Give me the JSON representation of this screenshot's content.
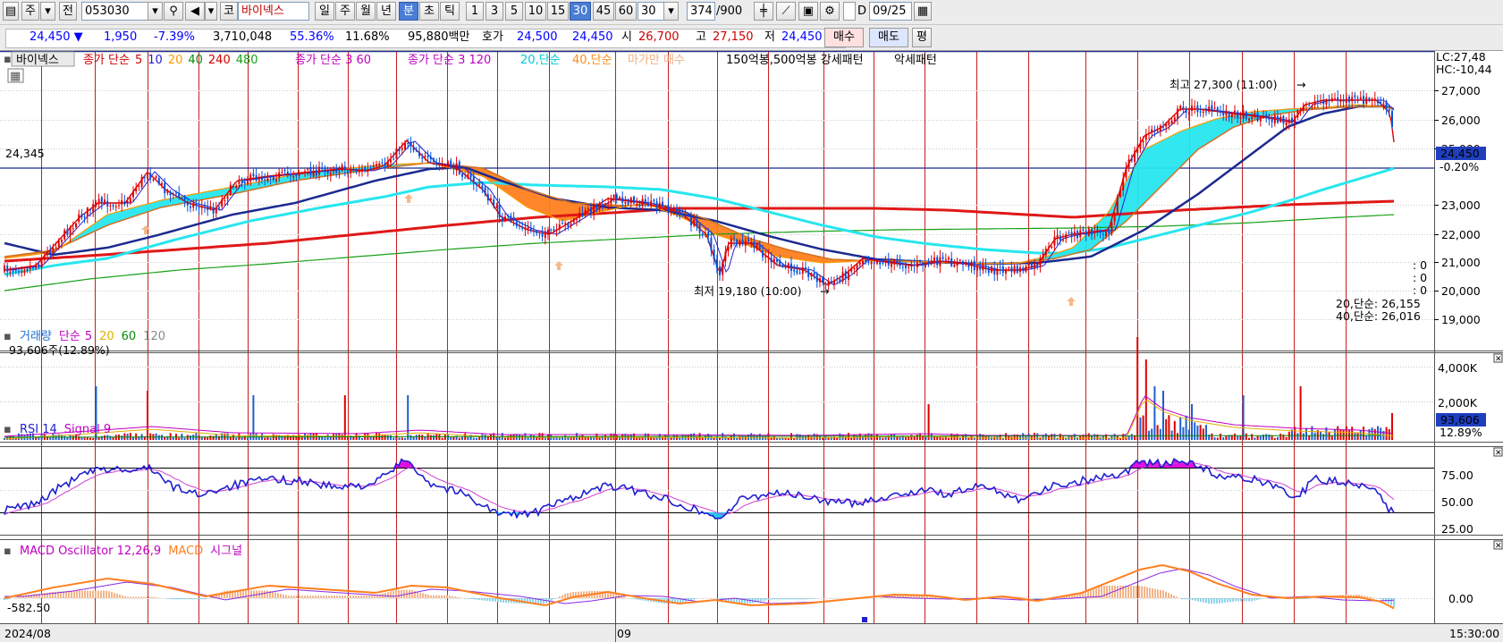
{
  "toolbar": {
    "main_label": "주",
    "prev_label": "전",
    "code_value": "053030",
    "market_label": "코",
    "stock_name": "바이넥스",
    "periods": [
      "일",
      "주",
      "월",
      "년",
      "분",
      "초",
      "틱"
    ],
    "intervals": [
      "1",
      "3",
      "5",
      "10",
      "15",
      "30",
      "45",
      "60"
    ],
    "interval_select": "30",
    "count": "374",
    "count_total": "/900",
    "d_label": "D",
    "date_value": "09/25"
  },
  "quote": {
    "price": "24,450",
    "change": "1,950",
    "change_pct": "-7.39%",
    "volume": "3,710,048",
    "vol_ratio": "55.36%",
    "turnover": "11.68%",
    "amount": "95,880백만",
    "hoga_label": "호가",
    "ask": "24,500",
    "bid": "24,450",
    "open_label": "시",
    "open": "26,700",
    "high_label": "고",
    "high": "27,150",
    "low_label": "저",
    "low": "24,450",
    "buy_label": "매수",
    "sell_label": "매도",
    "eval_label": "평"
  },
  "price_legend": {
    "name": "바이넥스",
    "ma_title": "종가 단순",
    "ma_periods": [
      "5",
      "10",
      "20",
      "40",
      "240",
      "480"
    ],
    "cloud1": "종가 단순 3 60",
    "cloud2": "종가 단순 3 120",
    "ma20": "20,단순",
    "ma40": "40,단순",
    "signal": "마가만 매수",
    "pattern": "150억봉,500억봉 강세패턴",
    "pattern2": "악세패턴"
  },
  "price_annot": {
    "hline_label": "24,345",
    "high_label": "최고 27,300 (11:00)",
    "low_label": "최저 19,180 (10:00)",
    "lc": "LC:27,48",
    "hc": "HC:-10,44",
    "last": "24,450",
    "last_pct": "-0.20%",
    "zero1": ": 0",
    "zero2": ": 0",
    "zero3": ": 0",
    "ma20_val": "20,단순: 26,155",
    "ma40_val": "40,단순: 26,016"
  },
  "price_axis": [
    "27,000",
    "26,000",
    "25,000",
    "23,000",
    "22,000",
    "21,000",
    "20,000",
    "19,000"
  ],
  "volume": {
    "title": "거래량",
    "ma_title": "단순",
    "ma_periods": [
      "5",
      "20",
      "60",
      "120"
    ],
    "value": "93,606주(12.89%)",
    "axis": [
      "4,000K",
      "2,000K"
    ],
    "last": "93,606",
    "last_pct": "12.89%"
  },
  "rsi": {
    "title": "RSI 14",
    "signal": "Signal 9",
    "axis": [
      "75.00",
      "50.00",
      "25.00"
    ]
  },
  "macd": {
    "title": "MACD Oscillator 12,26,9",
    "macd": "MACD",
    "signal": "시그널",
    "left_val": "-582.50",
    "axis": [
      "0.00"
    ]
  },
  "dates": {
    "start": "2024/08",
    "mid": "09",
    "end": "15:30:00"
  },
  "colors": {
    "ma5": "#e00000",
    "ma10": "#1f1fd0",
    "ma20": "#ff9900",
    "ma40": "#0a8a0a",
    "ma240": "#d00000",
    "ma480": "#16a016",
    "cyan": "#27e6ee",
    "orange": "#ff7f1f",
    "navy": "#1b2a8e",
    "red": "#e01818",
    "magenta": "#e010e0",
    "purple": "#8a2be2"
  }
}
